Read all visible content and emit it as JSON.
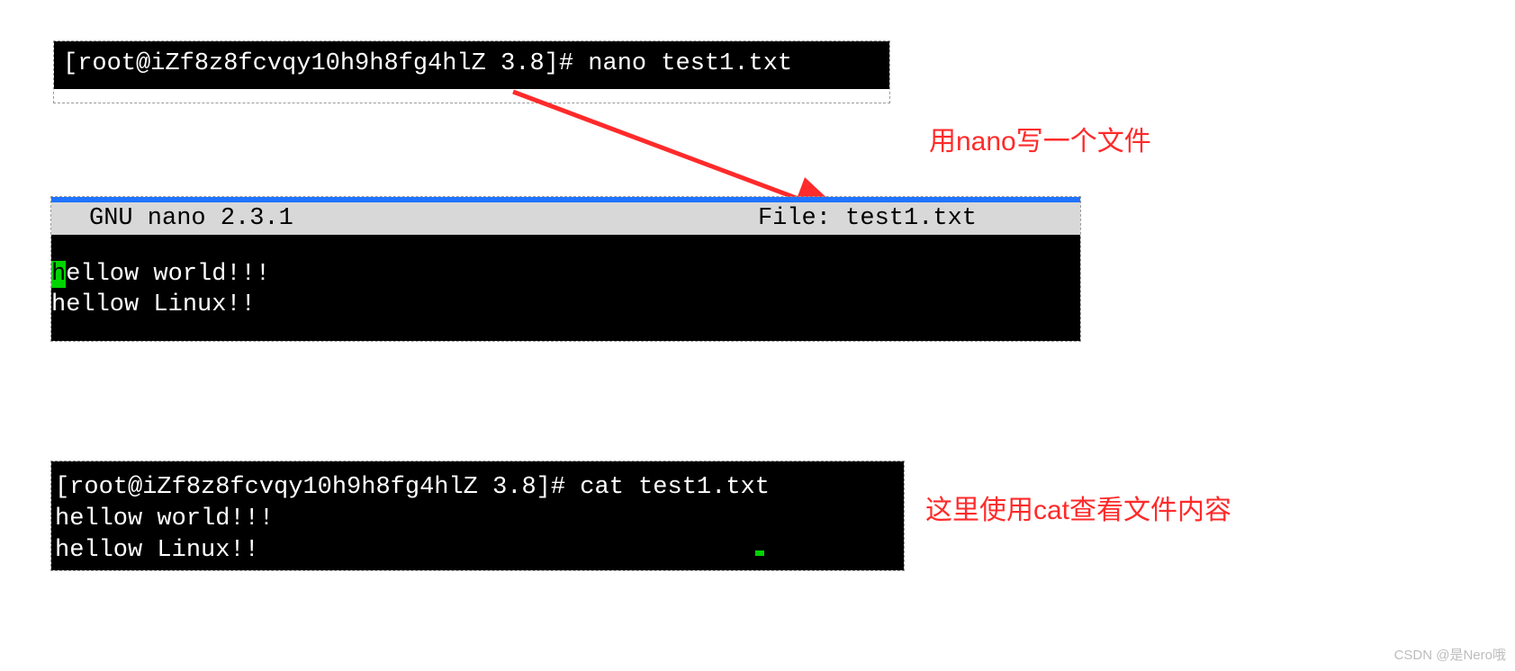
{
  "block1": {
    "prompt": "[root@iZf8z8fcvqy10h9h8fg4hlZ 3.8]# nano test1.txt"
  },
  "annot1": "用nano写一个文件",
  "nano": {
    "header_left": "GNU nano 2.3.1",
    "header_right": "File: test1.txt",
    "body_cursor": "h",
    "body_after_cursor": "ellow world!!!",
    "body_line2": "hellow Linux!!"
  },
  "block3": {
    "cmd": "[root@iZf8z8fcvqy10h9h8fg4hlZ 3.8]# cat test1.txt",
    "out1": "hellow world!!!",
    "out2": "hellow Linux!!"
  },
  "annot2": "这里使用cat查看文件内容",
  "watermark": "CSDN @是Nero哦"
}
